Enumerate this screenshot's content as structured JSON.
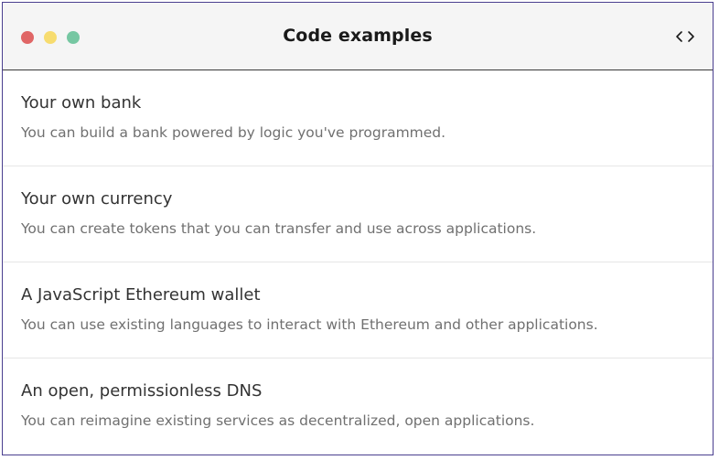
{
  "window": {
    "title": "Code examples",
    "controls": {
      "close_color": "#e06666",
      "minimize_color": "#f7dc6f",
      "maximize_color": "#76c7a2"
    },
    "toggle_icon": "code-brackets-icon"
  },
  "examples": [
    {
      "title": "Your own bank",
      "description": "You can build a bank powered by logic you've programmed."
    },
    {
      "title": "Your own currency",
      "description": "You can create tokens that you can transfer and use across applications."
    },
    {
      "title": "A JavaScript Ethereum wallet",
      "description": "You can use existing languages to interact with Ethereum and other applications."
    },
    {
      "title": "An open, permissionless DNS",
      "description": "You can reimagine existing services as decentralized, open applications."
    }
  ]
}
